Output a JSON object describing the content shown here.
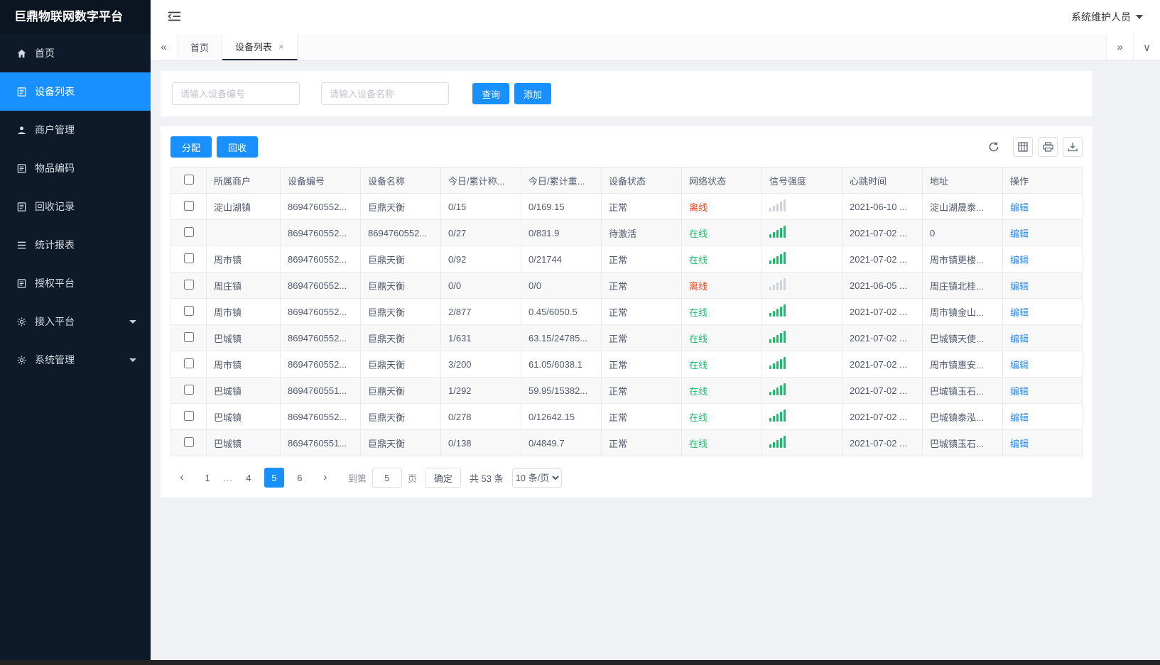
{
  "app": {
    "user_name": "系统维护人员"
  },
  "sidebar": {
    "title": "巨鼎物联网数字平台",
    "items": [
      {
        "key": "home",
        "label": "首页",
        "icon": "home-icon",
        "active": false,
        "expandable": false
      },
      {
        "key": "device-list",
        "label": "设备列表",
        "icon": "device-list-icon",
        "active": true,
        "expandable": false
      },
      {
        "key": "merchant-management",
        "label": "商户管理",
        "icon": "user-icon",
        "active": false,
        "expandable": false
      },
      {
        "key": "item-coding",
        "label": "物品编码",
        "icon": "document-icon",
        "active": false,
        "expandable": false
      },
      {
        "key": "recycle-records",
        "label": "回收记录",
        "icon": "document-icon",
        "active": false,
        "expandable": false
      },
      {
        "key": "statistics-report",
        "label": "统计报表",
        "icon": "report-icon",
        "active": false,
        "expandable": false
      },
      {
        "key": "authorization-platform",
        "label": "授权平台",
        "icon": "document-icon",
        "active": false,
        "expandable": false
      },
      {
        "key": "access-platform",
        "label": "接入平台",
        "icon": "gear-icon",
        "active": false,
        "expandable": true
      },
      {
        "key": "system-management",
        "label": "系统管理",
        "icon": "gear-icon",
        "active": false,
        "expandable": true
      }
    ]
  },
  "tabbar": {
    "items": [
      {
        "label": "首页",
        "active": false,
        "closable": false
      },
      {
        "label": "设备列表",
        "active": true,
        "closable": true
      }
    ]
  },
  "search": {
    "device_no_placeholder": "请输入设备编号",
    "device_name_placeholder": "请输入设备名称",
    "query_label": "查询",
    "add_label": "添加"
  },
  "toolbar": {
    "allocate_label": "分配",
    "recycle_label": "回收",
    "icons": [
      "refresh-icon",
      "column-grid-icon",
      "print-icon",
      "export-icon"
    ]
  },
  "table": {
    "columns": [
      "所属商户",
      "设备编号",
      "设备名称",
      "今日/累计称...",
      "今日/累计重...",
      "设备状态",
      "网络状态",
      "信号强度",
      "心跳时间",
      "地址",
      "操作"
    ],
    "edit_label": "编辑",
    "rows": [
      {
        "merchant": "淀山湖镇",
        "device_no": "8694760552...",
        "device_name": "巨鼎天衡",
        "today_count": "0/15",
        "today_weight": "0/169.15",
        "device_status": "正常",
        "network_status": "离线",
        "signal": "weak",
        "heartbeat": "2021-06-10 ...",
        "address": "淀山湖晟泰..."
      },
      {
        "merchant": "",
        "device_no": "8694760552...",
        "device_name": "8694760552...",
        "today_count": "0/27",
        "today_weight": "0/831.9",
        "device_status": "待激活",
        "network_status": "在线",
        "signal": "strong",
        "heartbeat": "2021-07-02 ...",
        "address": "0"
      },
      {
        "merchant": "周市镇",
        "device_no": "8694760552...",
        "device_name": "巨鼎天衡",
        "today_count": "0/92",
        "today_weight": "0/21744",
        "device_status": "正常",
        "network_status": "在线",
        "signal": "strong",
        "heartbeat": "2021-07-02 ...",
        "address": "周市镇更楼..."
      },
      {
        "merchant": "周庄镇",
        "device_no": "8694760552...",
        "device_name": "巨鼎天衡",
        "today_count": "0/0",
        "today_weight": "0/0",
        "device_status": "正常",
        "network_status": "离线",
        "signal": "weak",
        "heartbeat": "2021-06-05 ...",
        "address": "周庄镇北桂..."
      },
      {
        "merchant": "周市镇",
        "device_no": "8694760552...",
        "device_name": "巨鼎天衡",
        "today_count": "2/877",
        "today_weight": "0.45/6050.5",
        "device_status": "正常",
        "network_status": "在线",
        "signal": "strong",
        "heartbeat": "2021-07-02 ...",
        "address": "周市镇金山..."
      },
      {
        "merchant": "巴城镇",
        "device_no": "8694760552...",
        "device_name": "巨鼎天衡",
        "today_count": "1/631",
        "today_weight": "63.15/24785...",
        "device_status": "正常",
        "network_status": "在线",
        "signal": "strong",
        "heartbeat": "2021-07-02 ...",
        "address": "巴城镇天使..."
      },
      {
        "merchant": "周市镇",
        "device_no": "8694760552...",
        "device_name": "巨鼎天衡",
        "today_count": "3/200",
        "today_weight": "61.05/6038.1",
        "device_status": "正常",
        "network_status": "在线",
        "signal": "strong",
        "heartbeat": "2021-07-02 ...",
        "address": "周市镇惠安..."
      },
      {
        "merchant": "巴城镇",
        "device_no": "8694760551...",
        "device_name": "巨鼎天衡",
        "today_count": "1/292",
        "today_weight": "59.95/15382...",
        "device_status": "正常",
        "network_status": "在线",
        "signal": "strong",
        "heartbeat": "2021-07-02 ...",
        "address": "巴城镇玉石..."
      },
      {
        "merchant": "巴城镇",
        "device_no": "8694760552...",
        "device_name": "巨鼎天衡",
        "today_count": "0/278",
        "today_weight": "0/12642.15",
        "device_status": "正常",
        "network_status": "在线",
        "signal": "strong",
        "heartbeat": "2021-07-02 ...",
        "address": "巴城镇泰泓..."
      },
      {
        "merchant": "巴城镇",
        "device_no": "8694760551...",
        "device_name": "巨鼎天衡",
        "today_count": "0/138",
        "today_weight": "0/4849.7",
        "device_status": "正常",
        "network_status": "在线",
        "signal": "strong",
        "heartbeat": "2021-07-02 ...",
        "address": "巴城镇玉石..."
      }
    ]
  },
  "pagination": {
    "pages": [
      "1",
      "...",
      "4",
      "5",
      "6"
    ],
    "active_page": "5",
    "goto_label": "到第",
    "goto_value": "5",
    "page_word": "页",
    "confirm_label": "确定",
    "total_label": "共 53 条",
    "page_size_value": "10 条/页"
  },
  "colors": {
    "primary": "#1890ff",
    "online_green": "#19be6b",
    "offline_red": "#ed3f14",
    "sidebar_bg": "#0e1a29"
  }
}
